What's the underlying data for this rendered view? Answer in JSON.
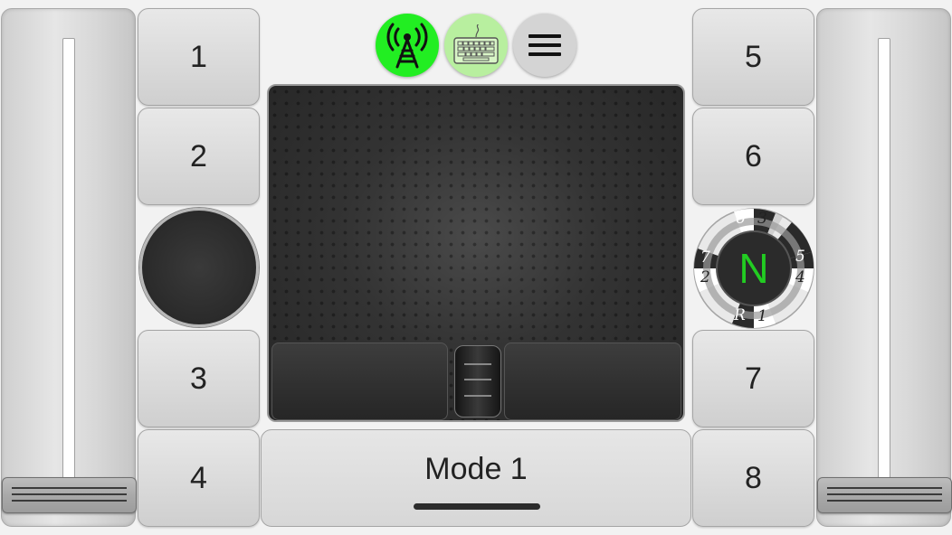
{
  "buttons": {
    "b1": "1",
    "b2": "2",
    "b3": "3",
    "b4": "4",
    "b5": "5",
    "b6": "6",
    "b7": "7",
    "b8": "8"
  },
  "mode": {
    "label": "Mode 1"
  },
  "top_icons": [
    {
      "name": "antenna-icon",
      "color": "#22ee22"
    },
    {
      "name": "keyboard-icon",
      "color": "#b8ef9f"
    },
    {
      "name": "menu-icon",
      "color": "#d4d4d4"
    }
  ],
  "gear_selector": {
    "current": "N",
    "current_color": "#22cc22",
    "positions": [
      "6",
      "3",
      "5",
      "4",
      "1",
      "R",
      "2",
      "7"
    ]
  }
}
